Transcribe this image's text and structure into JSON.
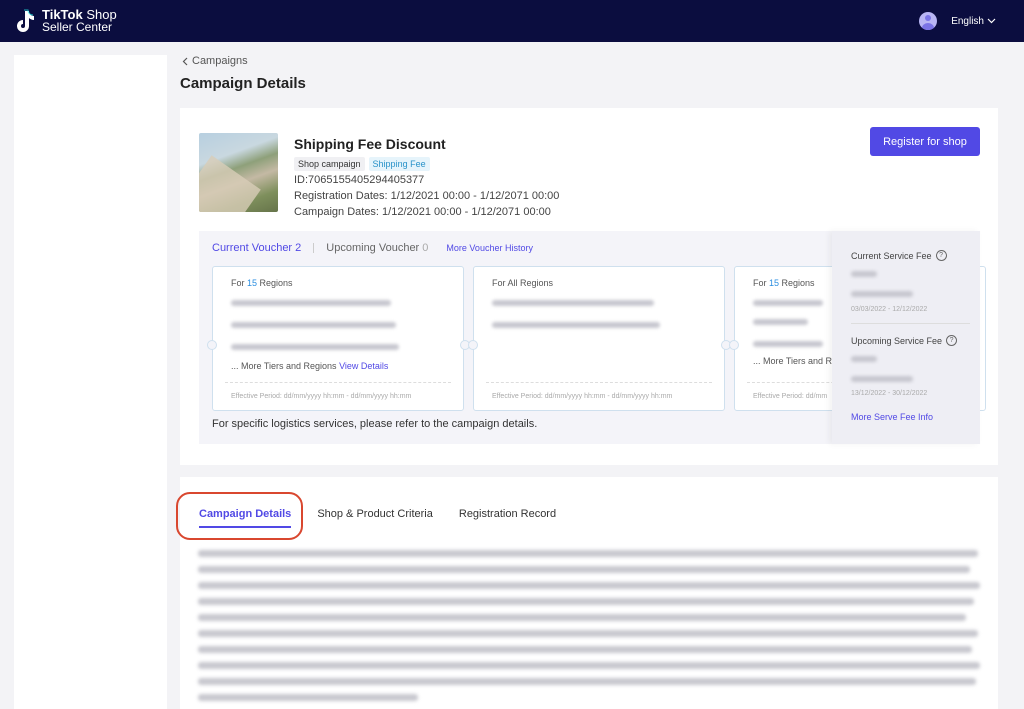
{
  "topbar": {
    "brand_main": "TikTok",
    "brand_shop": " Shop",
    "brand_sub": "Seller Center",
    "language": "English"
  },
  "breadcrumb": {
    "back_label": "Campaigns"
  },
  "page": {
    "title": "Campaign Details"
  },
  "campaign": {
    "name": "Shipping Fee Discount",
    "tags": [
      "Shop campaign",
      "Shipping Fee"
    ],
    "id_line": "ID:7065155405294405377",
    "registration_line": "Registration Dates:  1/12/2021 00:00 - 1/12/2071 00:00",
    "campaign_line": "Campaign Dates: 1/12/2021 00:00 - 1/12/2071 00:00",
    "register_button": "Register for shop"
  },
  "vouchers": {
    "current_tab": "Current Voucher 2",
    "upcoming_tab": "Upcoming Voucher",
    "upcoming_count": "0",
    "history_link": "More Voucher History",
    "cards": [
      {
        "head_prefix": "For ",
        "head_count": "15",
        "head_suffix": " Regions",
        "more_text": "... More Tiers and Regions ",
        "more_link": "View Details",
        "period": "Effective Period: dd/mm/yyyy hh:mm - dd/mm/yyyy hh:mm"
      },
      {
        "head_prefix": "For All Regions",
        "head_count": "",
        "head_suffix": "",
        "more_text": "",
        "more_link": "",
        "period": "Effective Period: dd/mm/yyyy hh:mm - dd/mm/yyyy hh:mm"
      },
      {
        "head_prefix": "For ",
        "head_count": "15",
        "head_suffix": " Regions",
        "more_text": "... More Tiers and R",
        "more_link": "",
        "period": "Effective Period: dd/mm"
      }
    ],
    "note": "For specific logistics services, please refer to the campaign details."
  },
  "service_fee": {
    "current_label": "Current Service Fee",
    "current_dates": "03/03/2022 - 12/12/2022",
    "upcoming_label": "Upcoming Service Fee",
    "upcoming_dates": "13/12/2022 - 30/12/2022",
    "more_link": "More Serve Fee Info"
  },
  "details_tabs": [
    "Campaign Details",
    "Shop & Product Criteria",
    "Registration Record"
  ],
  "colors": {
    "accent": "#5149e5",
    "topbar": "#0b0d3f",
    "highlight": "#d9472f"
  }
}
